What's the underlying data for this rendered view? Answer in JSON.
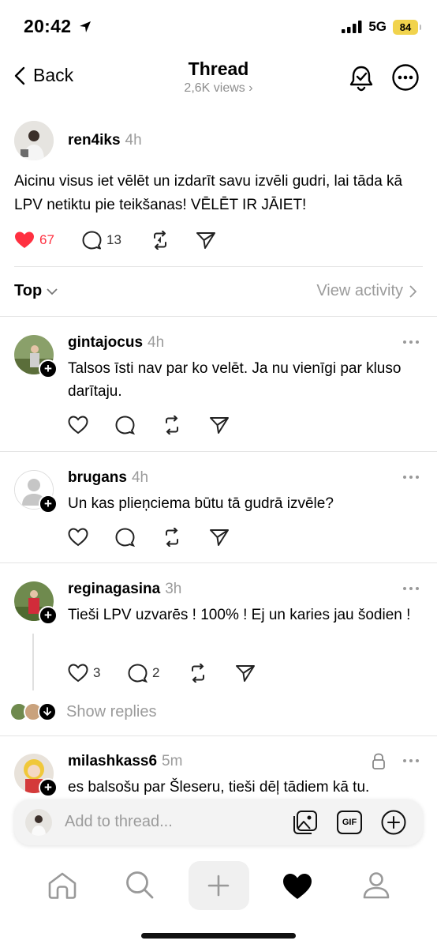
{
  "status_bar": {
    "time": "20:42",
    "network": "5G",
    "battery": "84"
  },
  "header": {
    "back_label": "Back",
    "title": "Thread",
    "views": "2,6K views"
  },
  "post": {
    "username": "ren4iks",
    "time": "4h",
    "text": "Aicinu visus iet vēlēt un izdarīt savu izvēli gudri, lai tāda kā LPV netiktu pie teikšanas! VĒLĒT IR JĀIET!",
    "likes": "67",
    "comments": "13"
  },
  "sort": {
    "label": "Top",
    "view_activity": "View activity"
  },
  "replies": [
    {
      "username": "gintajocus",
      "time": "4h",
      "text": "Talsos īsti nav par ko velēt. Ja nu vienīgi par kluso darītaju.",
      "likes": "",
      "comments": ""
    },
    {
      "username": "brugans",
      "time": "4h",
      "text": "Un kas plieņciema būtu tā gudrā izvēle?",
      "likes": "",
      "comments": ""
    },
    {
      "username": "reginagasina",
      "time": "3h",
      "text": "Tieši LPV uzvarēs ! 100% ! Ej un karies jau šodien !",
      "likes": "3",
      "comments": "2"
    },
    {
      "username": "milashkass6",
      "time": "5m",
      "text": "es balsošu par Šleseru, tieši dēļ tādiem kā tu.",
      "likes": "",
      "comments": ""
    }
  ],
  "show_replies": "Show replies",
  "composer": {
    "placeholder": "Add to thread...",
    "gif_label": "GIF"
  },
  "colors": {
    "like_red": "#ff3040",
    "muted": "#9b9b9b"
  }
}
